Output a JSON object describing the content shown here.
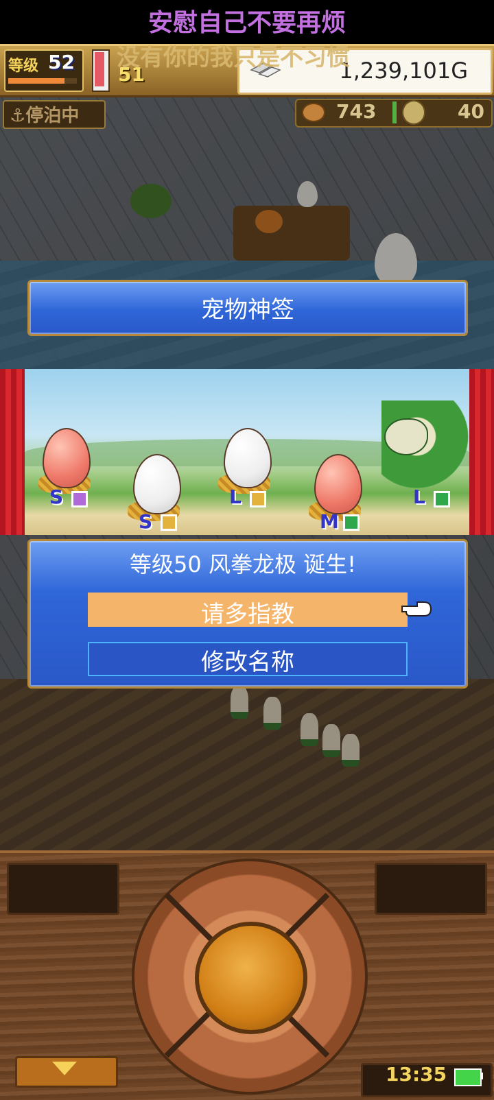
{
  "overlay": {
    "lyric_line1": "安慰自己不要再烦",
    "lyric_line2": "没有你的我只是不习惯"
  },
  "hud": {
    "level_label": "等级",
    "level_value": "52",
    "level_progress_percent": 82,
    "energy_value": "51",
    "gold_value": "1,239,101G",
    "dock_status": "停泊中",
    "resource1_value": "743",
    "resource2_value": "40"
  },
  "title_banner": "宠物神签",
  "eggs": [
    {
      "label": "S",
      "color": "pink",
      "badge_color": "#b06ad8"
    },
    {
      "label": "S",
      "color": "white",
      "badge_color": "#e3b23d"
    },
    {
      "label": "L",
      "color": "white",
      "badge_color": "#e3b23d"
    },
    {
      "label": "M",
      "color": "pink",
      "badge_color": "#2ea84a"
    },
    {
      "label": "L",
      "color": "dragon",
      "badge_color": "#2ea84a"
    }
  ],
  "dialog": {
    "message": "等级50 风拳龙极 诞生!",
    "confirm_label": "请多指教",
    "rename_label": "修改名称"
  },
  "status": {
    "clock": "13:35"
  },
  "colors": {
    "dialog_blue": "#2f66d8",
    "selected_option": "#f4b46a",
    "gold_text": "#f4d25a"
  }
}
